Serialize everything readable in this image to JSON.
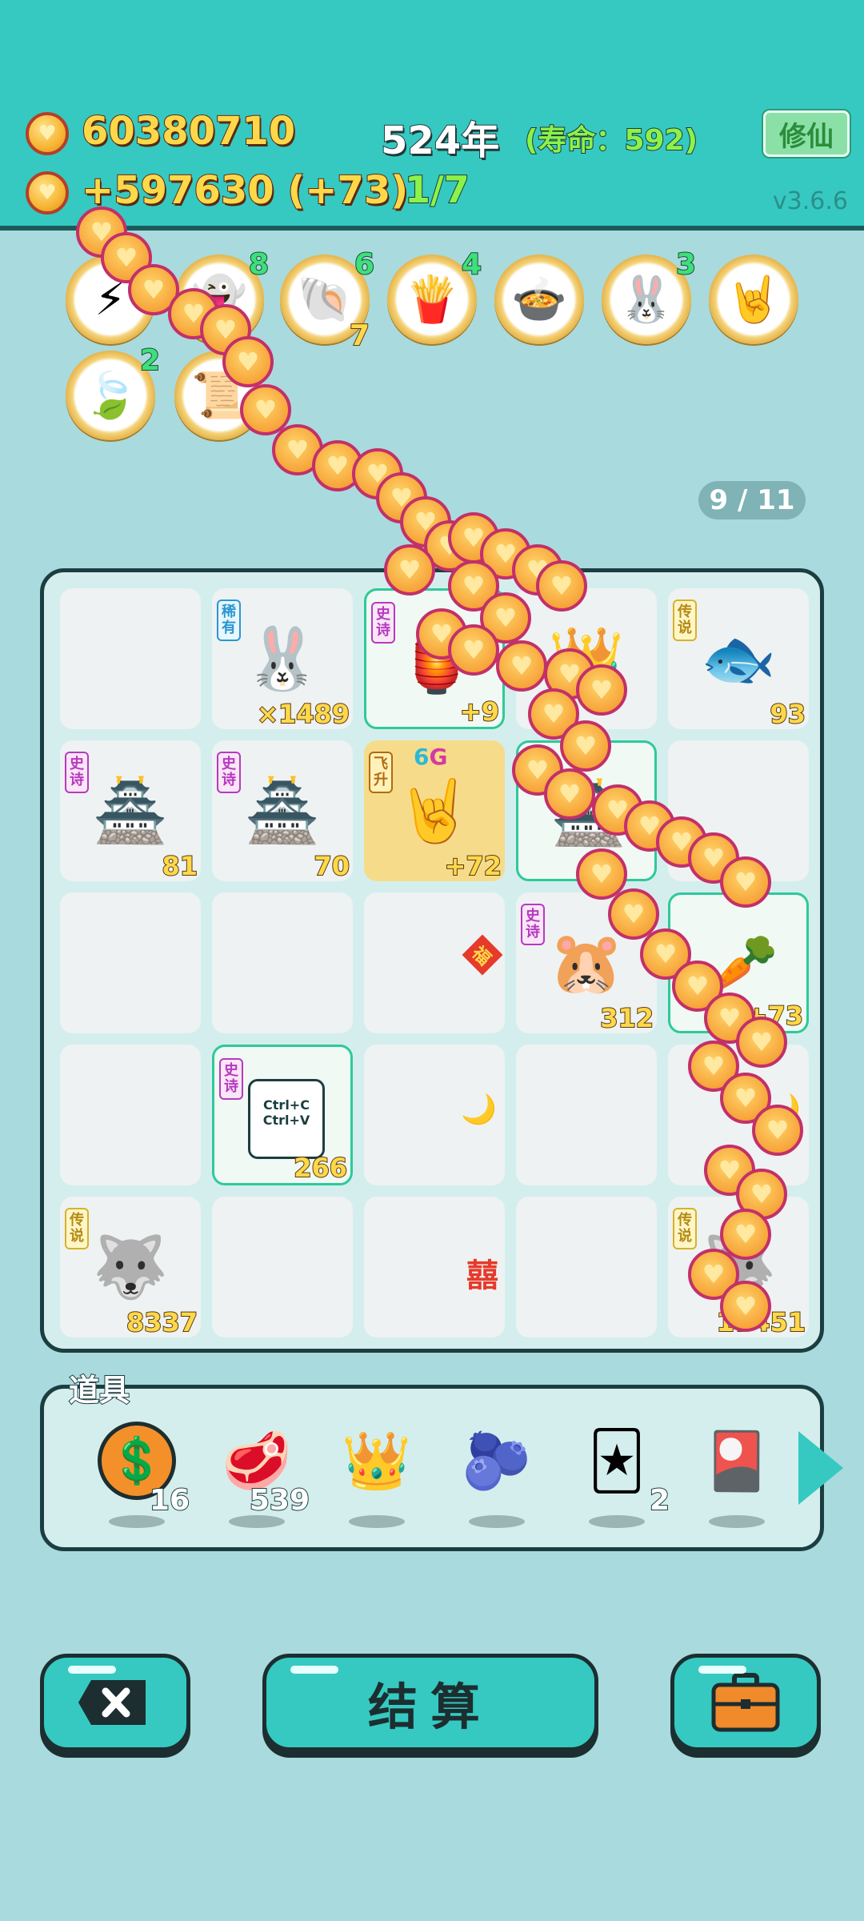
{
  "header": {
    "coins": "60380710",
    "income": "+597630 (+73)",
    "year": "524年",
    "lifespan": "(寿命：592)",
    "progress": "1/7",
    "cultivate_button": "修仙",
    "version": "v3.6.6"
  },
  "skills": [
    {
      "icon": "lightning-icon",
      "glyph": "⚡",
      "count": ""
    },
    {
      "icon": "ghost-icon",
      "glyph": "👻",
      "count": "8"
    },
    {
      "icon": "shell-icon",
      "glyph": "🐚",
      "count": "6",
      "count2": "7"
    },
    {
      "icon": "fries-icon",
      "glyph": "🍟",
      "count": "4"
    },
    {
      "icon": "bowls-icon",
      "glyph": "🍲",
      "count": ""
    },
    {
      "icon": "rabbit-icon",
      "glyph": "🐰",
      "count": "3"
    },
    {
      "icon": "rock-hand-icon",
      "glyph": "🤘",
      "count": ""
    },
    {
      "icon": "leaf-icon",
      "glyph": "🍃",
      "count": "2"
    },
    {
      "icon": "note-icon",
      "glyph": "📜",
      "count": ""
    }
  ],
  "page_indicator": "9 / 11",
  "grid": [
    {
      "art": "",
      "tag": "",
      "tag_type": "",
      "count": ""
    },
    {
      "art": "🐰",
      "tag": "稀有",
      "tag_type": "rare",
      "count": "×1489"
    },
    {
      "art": "🏮",
      "tag": "史诗",
      "tag_type": "epic",
      "count": "+9"
    },
    {
      "art": "👑",
      "tag": "",
      "tag_type": "",
      "count": ""
    },
    {
      "art": "🐟",
      "tag": "传说",
      "tag_type": "legend",
      "count": "93"
    },
    {
      "art": "🏯",
      "tag": "史诗",
      "tag_type": "epic",
      "count": "81"
    },
    {
      "art": "🏯",
      "tag": "史诗",
      "tag_type": "epic",
      "count": "70"
    },
    {
      "art": "🤘",
      "tag": "飞升",
      "tag_type": "fly",
      "count": "+72",
      "g6a": "6",
      "g6b": "G"
    },
    {
      "art": "🏯",
      "tag": "诗",
      "tag_type": "epic",
      "count": ""
    },
    {
      "art": "",
      "tag": "",
      "tag_type": "",
      "count": ""
    },
    {
      "art": "",
      "tag": "",
      "tag_type": "",
      "count": ""
    },
    {
      "art": "",
      "tag": "",
      "tag_type": "",
      "count": ""
    },
    {
      "art": "",
      "tag": "",
      "tag_type": "",
      "count": "",
      "deco": "福"
    },
    {
      "art": "🐹",
      "tag": "史诗",
      "tag_type": "epic",
      "count": "312"
    },
    {
      "art": "🥕",
      "tag": "",
      "tag_type": "",
      "count": "+73"
    },
    {
      "art": "",
      "tag": "",
      "tag_type": "",
      "count": ""
    },
    {
      "art": "📋",
      "tag": "史诗",
      "tag_type": "epic",
      "count": "266",
      "ctrl1": "Ctrl+C",
      "ctrl2": "Ctrl+V"
    },
    {
      "art": "",
      "tag": "",
      "tag_type": "",
      "count": "",
      "deco": "🌙"
    },
    {
      "art": "",
      "tag": "",
      "tag_type": "",
      "count": ""
    },
    {
      "art": "",
      "tag": "",
      "tag_type": "",
      "count": "",
      "deco": "🌙"
    },
    {
      "art": "🐺",
      "tag": "传说",
      "tag_type": "legend",
      "count": "8337"
    },
    {
      "art": "",
      "tag": "",
      "tag_type": "",
      "count": ""
    },
    {
      "art": "",
      "tag": "",
      "tag_type": "",
      "count": "",
      "deco": "囍"
    },
    {
      "art": "",
      "tag": "",
      "tag_type": "",
      "count": ""
    },
    {
      "art": "🐺",
      "tag": "传说",
      "tag_type": "legend",
      "count": "17451"
    }
  ],
  "props": {
    "label": "道具",
    "items": [
      {
        "icon": "coin-icon",
        "glyph": "💲",
        "count": "16"
      },
      {
        "icon": "liver-icon",
        "glyph": "🥩",
        "count": "539"
      },
      {
        "icon": "crown-icon",
        "glyph": "👑",
        "count": ""
      },
      {
        "icon": "blueberry-icon",
        "glyph": "🫐",
        "count": ""
      },
      {
        "icon": "cards-icon",
        "glyph": "🃏",
        "count": "2"
      },
      {
        "icon": "rare-cards-icon",
        "glyph": "🎴",
        "count": ""
      }
    ]
  },
  "buttons": {
    "settle": "结算"
  },
  "colors": {
    "accent": "#36c9c1",
    "background": "#a9dadd",
    "outline": "#1c3e40"
  }
}
